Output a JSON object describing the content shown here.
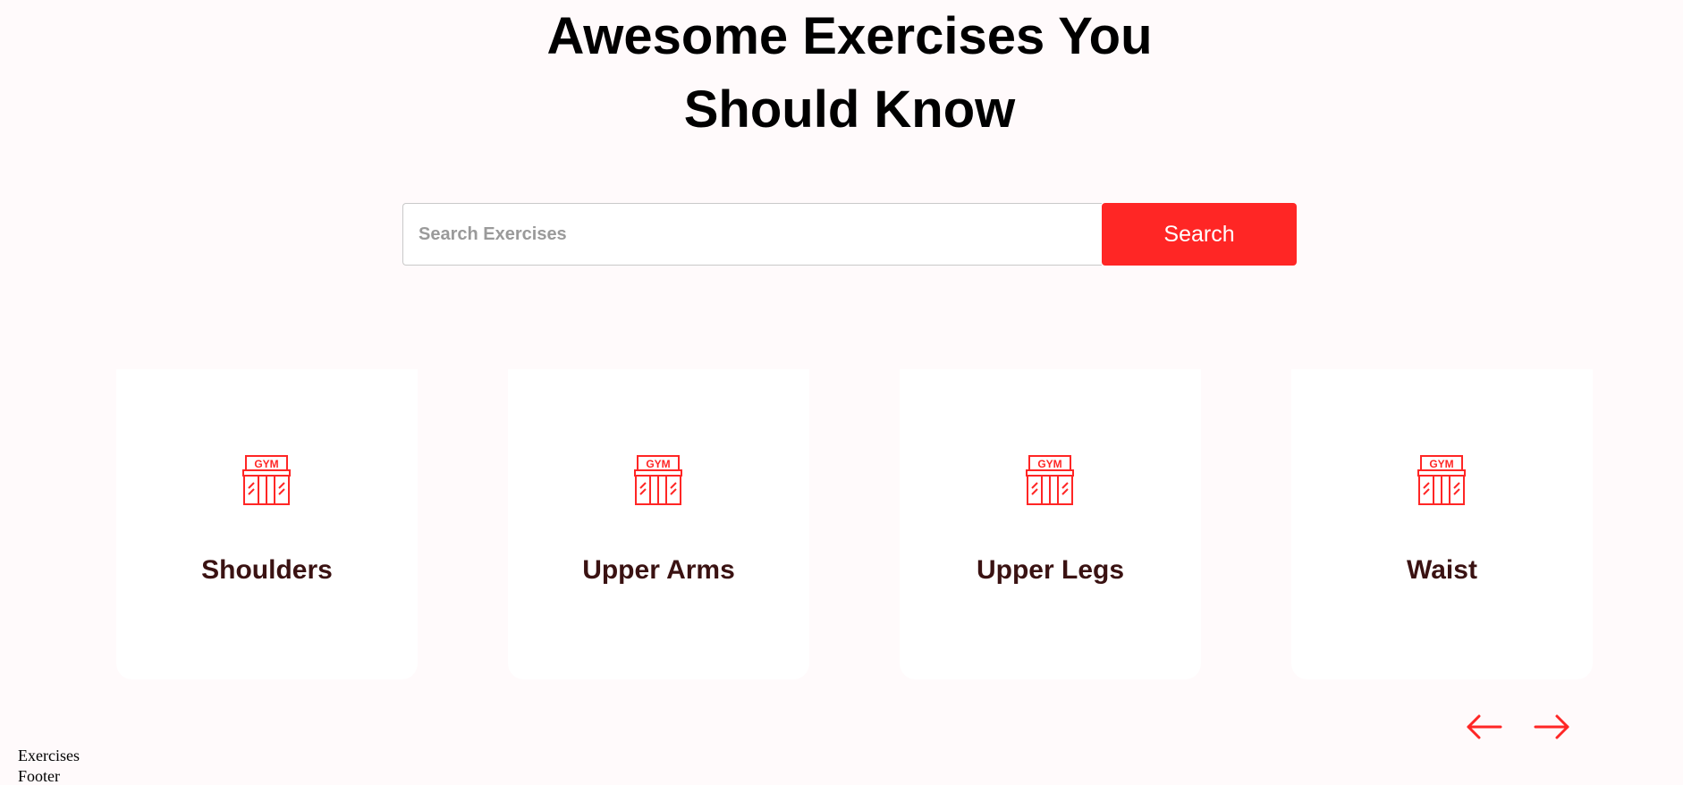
{
  "hero": {
    "title_line1": "Awesome Exercises You",
    "title_line2": "Should Know"
  },
  "search": {
    "placeholder": "Search Exercises",
    "value": "",
    "button_label": "Search"
  },
  "categories": [
    {
      "label": "Shoulders",
      "icon": "gym-icon"
    },
    {
      "label": "Upper Arms",
      "icon": "gym-icon"
    },
    {
      "label": "Upper Legs",
      "icon": "gym-icon"
    },
    {
      "label": "Waist",
      "icon": "gym-icon"
    }
  ],
  "icon_text": "GYM",
  "carousel": {
    "prev_icon": "arrow-left-icon",
    "next_icon": "arrow-right-icon"
  },
  "sections": {
    "exercises": "Exercises",
    "footer": "Footer"
  },
  "colors": {
    "accent": "#ff2625",
    "background": "#fffafb",
    "card": "#ffffff",
    "label": "#3a1212"
  }
}
